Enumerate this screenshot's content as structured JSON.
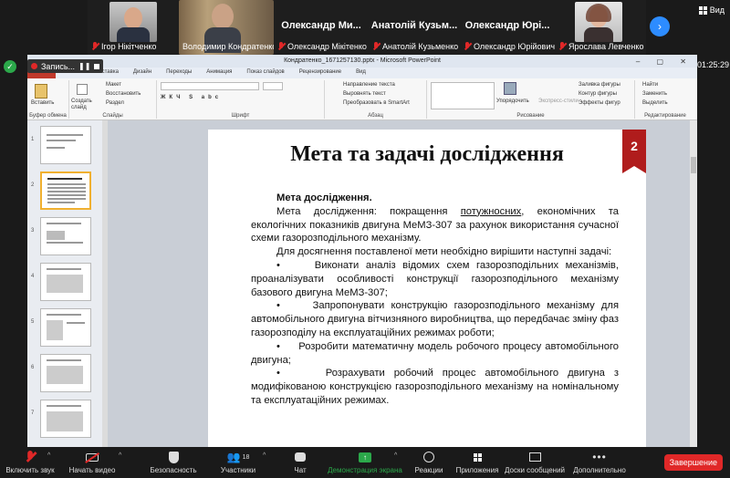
{
  "participants": [
    {
      "name": "Ігор Нікітченко",
      "muted": true,
      "photo": true
    },
    {
      "name": "Володимир Кондратенко",
      "muted": false,
      "photo": true
    },
    {
      "name": "Олександр  Ми...",
      "label": "Олександр Мікітенко",
      "muted": true,
      "photo": false
    },
    {
      "name": "Анатолій  Кузьм...",
      "label": "Анатолій Кузьменко",
      "muted": true,
      "photo": false
    },
    {
      "name": "Олександр  Юрі...",
      "label": "Олександр Юрійович",
      "muted": true,
      "photo": false
    },
    {
      "name": "Ярослава Левченко",
      "muted": true,
      "photo": true
    }
  ],
  "view_label": "Вид",
  "recording_label": "Запись...",
  "meeting_timer": "01:25:29",
  "powerpoint": {
    "window_title": "Кондратенко_1671257130.pptx - Microsoft PowerPoint",
    "tabs": [
      "Файл",
      "Главная",
      "Вставка",
      "Дизайн",
      "Переходы",
      "Анимация",
      "Показ слайдов",
      "Рецензирование",
      "Вид"
    ],
    "ribbon_groups": [
      "Буфер обмена",
      "Слайды",
      "Шрифт",
      "Абзац",
      "Рисование",
      "Редактирование"
    ],
    "ribbon_buttons": {
      "paste": "Вставить",
      "create_slide": "Создать слайд",
      "layout": "Макет",
      "reset": "Восстановить",
      "section": "Раздел",
      "text_direction": "Направление текста",
      "align_text": "Выровнять текст",
      "smartart": "Преобразовать в SmartArt",
      "arrange": "Упорядочить",
      "quick_styles": "Экспресс-стили",
      "shape_fill": "Заливка фигуры",
      "shape_outline": "Контур фигуры",
      "shape_effects": "Эффекты фигур",
      "find": "Найти",
      "replace": "Заменить",
      "select": "Выделить"
    },
    "thumb_numbers": [
      "1",
      "2",
      "3",
      "4",
      "5",
      "6",
      "7"
    ]
  },
  "slide": {
    "number": "2",
    "title": "Мета та задачі дослідження",
    "heading": "Мета дослідження.",
    "para1_before": "Мета дослідження: покращення ",
    "para1_underlined": "потужносних",
    "para1_after": ", економічних та екологічних показників двигуна МеМЗ-307 за рахунок використання сучасної схеми газорозподільного механізму.",
    "para2": "Для досягнення поставленої мети необхідно вирішити наступні задачі:",
    "bullets": [
      "Виконати аналіз відомих схем газорозподільних механізмів, проаналізувати особливості конструкції газорозподільного механізму базового двигуна МеМЗ-307;",
      "Запропонувати конструкцію газорозподільного механізму для автомобільного двигуна вітчизняного виробництва, що передбачає зміну фаз газорозподілу на експлуатаційних режимах роботи;",
      "Розробити математичну модель робочого процесу автомобільного двигуна;",
      "Розрахувати робочий процес автомобільного двигуна з модифікованою конструкцією газорозподільного механізму на номінальному та експлуатаційних режимах."
    ]
  },
  "toolbar": {
    "mute": "Включить звук",
    "video": "Начать видео",
    "security": "Безопасность",
    "participants": "Участники",
    "participants_count": "18",
    "chat": "Чат",
    "share": "Демонстрация экрана",
    "reactions": "Реакции",
    "apps": "Приложения",
    "whiteboards": "Доски сообщений",
    "more": "Дополнительно",
    "end": "Завершение"
  },
  "colors": {
    "accent_red": "#e02828",
    "share_green": "#2ba84a",
    "badge_red": "#b01c1c",
    "zoom_blue": "#2d8cff"
  }
}
